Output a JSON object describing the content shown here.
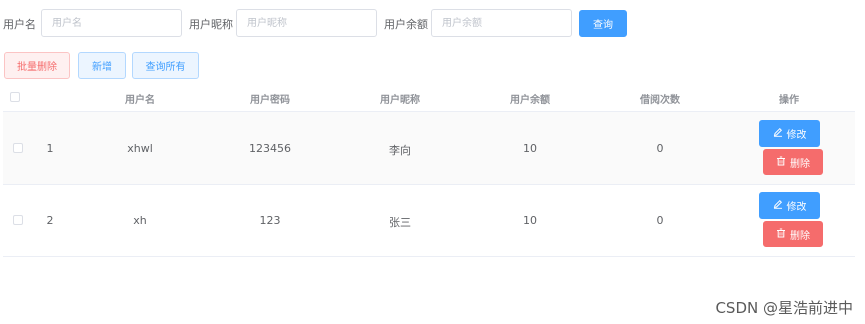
{
  "search": {
    "username": {
      "label": "用户名",
      "placeholder": "用户名",
      "value": ""
    },
    "nickname": {
      "label": "用户昵称",
      "placeholder": "用户昵称",
      "value": ""
    },
    "balance": {
      "label": "用户余额",
      "placeholder": "用户余额",
      "value": ""
    },
    "query_label": "查询"
  },
  "toolbar": {
    "batch_delete_label": "批量删除",
    "add_label": "新增",
    "query_all_label": "查询所有"
  },
  "table": {
    "headers": [
      "",
      "用户名",
      "用户密码",
      "用户昵称",
      "用户余额",
      "借阅次数",
      "操作"
    ],
    "rows": [
      {
        "id": "1",
        "username": "xhwl",
        "password": "123456",
        "nickname": "李向",
        "balance": "10",
        "borrow_count": "0"
      },
      {
        "id": "2",
        "username": "xh",
        "password": "123",
        "nickname": "张三",
        "balance": "10",
        "borrow_count": "0"
      }
    ],
    "edit_label": "修改",
    "delete_label": "删除"
  },
  "watermark": "CSDN @星浩前进中",
  "colors": {
    "primary": "#409eff",
    "danger": "#f56c6c",
    "header_text": "#909399",
    "row_stripe": "#fafafa"
  },
  "icons": {
    "edit": "edit-icon",
    "delete": "trash-icon"
  }
}
